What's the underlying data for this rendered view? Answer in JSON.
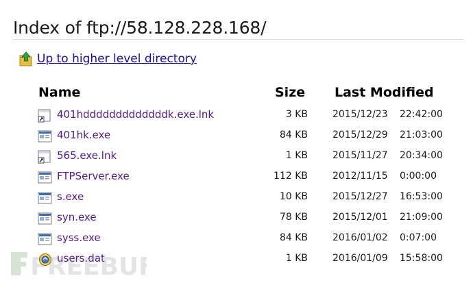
{
  "page": {
    "title": "Index of ftp://58.128.228.168/",
    "up_link": "Up to higher level directory"
  },
  "listing": {
    "headers": {
      "name": "Name",
      "size": "Size",
      "modified": "Last Modified"
    },
    "rows": [
      {
        "name": "401hdddddddddddddk.exe.lnk",
        "size": "3 KB",
        "date": "2015/12/23",
        "time": "22:42:00",
        "icon": "shortcut-file-icon"
      },
      {
        "name": "401hk.exe",
        "size": "84 KB",
        "date": "2015/12/29",
        "time": "21:03:00",
        "icon": "executable-file-icon"
      },
      {
        "name": "565.exe.lnk",
        "size": "1 KB",
        "date": "2015/11/27",
        "time": "20:34:00",
        "icon": "shortcut-file-icon"
      },
      {
        "name": "FTPServer.exe",
        "size": "112 KB",
        "date": "2012/11/15",
        "time": "0:00:00",
        "icon": "executable-file-icon"
      },
      {
        "name": "s.exe",
        "size": "10 KB",
        "date": "2015/12/27",
        "time": "16:53:00",
        "icon": "executable-file-icon"
      },
      {
        "name": "syn.exe",
        "size": "78 KB",
        "date": "2015/12/01",
        "time": "21:09:00",
        "icon": "executable-file-icon"
      },
      {
        "name": "syss.exe",
        "size": "84 KB",
        "date": "2016/01/02",
        "time": "0:07:00",
        "icon": "executable-file-icon"
      },
      {
        "name": "users.dat",
        "size": "1 KB",
        "date": "2016/01/09",
        "time": "15:58:00",
        "icon": "data-file-icon"
      }
    ]
  },
  "watermark": {
    "text": "FREEBUF"
  },
  "colors": {
    "link": "#1a0dab",
    "visited": "#551a8b",
    "rule": "#d8d8d8"
  }
}
